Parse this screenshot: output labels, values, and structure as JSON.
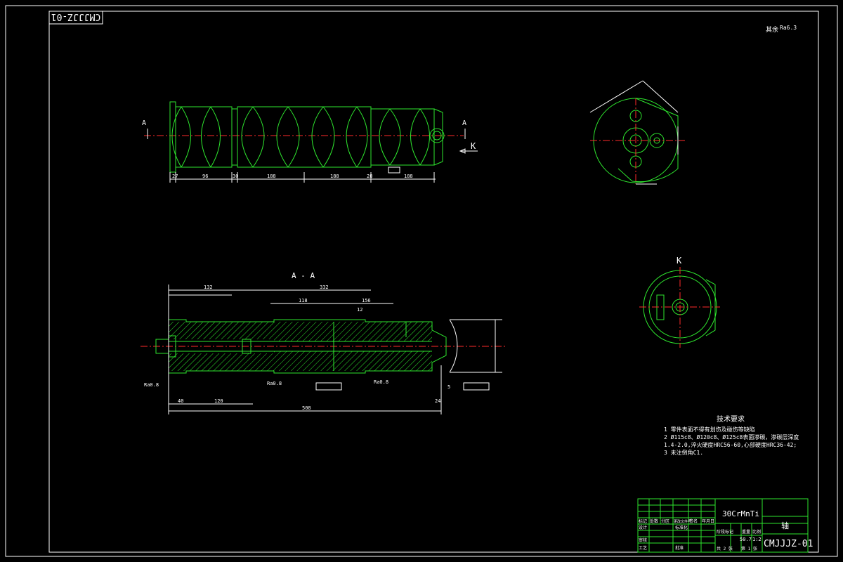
{
  "drawing": {
    "stamp_top": "CMJJJZ-01",
    "roughness_note_a": "其余",
    "roughness_note_b": "Ra6.3",
    "view_top_label_left": "A",
    "view_top_label_right": "A",
    "view_k_arrow": "K",
    "section_title": "A - A",
    "k_view_title": "K",
    "dims_top": [
      "27",
      "96",
      "30",
      "188",
      "188",
      "28",
      "188"
    ],
    "dims_section": [
      "132",
      "332",
      "12",
      "118",
      "156",
      "508",
      "40",
      "120",
      "24",
      "5"
    ],
    "roughness_marks": [
      "Ra0.8",
      "Ra0.8",
      "Ra0.8"
    ],
    "tech_req": {
      "title": "技术要求",
      "items": [
        "1  零件表面不得有划伤及碰伤等缺陷",
        "2  Ø115c8、Ø120c8、Ø125c8表面渗碳，渗碳层深度",
        "1.4-2.0,淬火硬度HRC56-60,心部硬度HRC36-42;",
        "3  未注倒角C1."
      ]
    },
    "title_block": {
      "material": "30CrMnTi",
      "part_name": "轴",
      "drawing_no": "CMJJJZ-01",
      "scale": "1:2",
      "weight": "50.7",
      "row_labels": [
        "标记",
        "处数",
        "分区",
        "更改文件号",
        "签名",
        "年月日"
      ],
      "side_labels": [
        "设计",
        "审核",
        "工艺"
      ],
      "std_label": "标准化",
      "approve_label": "批准",
      "stage_label": "阶段标记",
      "weight_label": "重量",
      "scale_label": "比例",
      "sheet_total": "共 2 张",
      "sheet_no": "第 1 张"
    }
  }
}
